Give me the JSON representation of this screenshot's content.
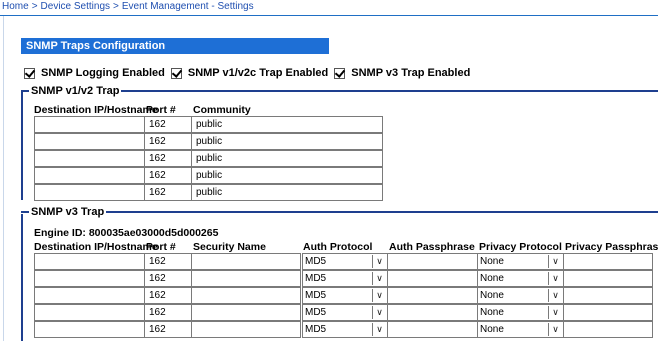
{
  "breadcrumb": {
    "home": "Home",
    "device_settings": "Device Settings",
    "current": "Event Management - Settings",
    "separator": ">"
  },
  "section_title": "SNMP Traps Configuration",
  "checkboxes": [
    {
      "label": "SNMP Logging Enabled",
      "checked": true
    },
    {
      "label": "SNMP v1/v2c Trap Enabled",
      "checked": true
    },
    {
      "label": "SNMP v3 Trap Enabled",
      "checked": true
    }
  ],
  "v1v2": {
    "legend": "SNMP v1/v2 Trap",
    "headers": {
      "destination": "Destination IP/Hostname",
      "port": "Port #",
      "community": "Community"
    },
    "rows": [
      {
        "destination": "",
        "port": "162",
        "community": "public"
      },
      {
        "destination": "",
        "port": "162",
        "community": "public"
      },
      {
        "destination": "",
        "port": "162",
        "community": "public"
      },
      {
        "destination": "",
        "port": "162",
        "community": "public"
      },
      {
        "destination": "",
        "port": "162",
        "community": "public"
      }
    ]
  },
  "v3": {
    "legend": "SNMP v3 Trap",
    "engine_id": "Engine ID: 800035ae03000d5d000265",
    "headers": {
      "destination": "Destination IP/Hostname",
      "port": "Port #",
      "security_name": "Security Name",
      "auth_protocol": "Auth Protocol",
      "auth_passphrase": "Auth Passphrase",
      "privacy_protocol": "Privacy Protocol",
      "privacy_passphrase": "Privacy Passphrase"
    },
    "rows": [
      {
        "destination": "",
        "port": "162",
        "security_name": "",
        "auth_protocol": "MD5",
        "auth_passphrase": "",
        "privacy_protocol": "None",
        "privacy_passphrase": ""
      },
      {
        "destination": "",
        "port": "162",
        "security_name": "",
        "auth_protocol": "MD5",
        "auth_passphrase": "",
        "privacy_protocol": "None",
        "privacy_passphrase": ""
      },
      {
        "destination": "",
        "port": "162",
        "security_name": "",
        "auth_protocol": "MD5",
        "auth_passphrase": "",
        "privacy_protocol": "None",
        "privacy_passphrase": ""
      },
      {
        "destination": "",
        "port": "162",
        "security_name": "",
        "auth_protocol": "MD5",
        "auth_passphrase": "",
        "privacy_protocol": "None",
        "privacy_passphrase": ""
      },
      {
        "destination": "",
        "port": "162",
        "security_name": "",
        "auth_protocol": "MD5",
        "auth_passphrase": "",
        "privacy_protocol": "None",
        "privacy_passphrase": ""
      }
    ]
  },
  "icons": {
    "dropdown": "chevron-down-icon",
    "checkbox": "checkmark-icon"
  },
  "colors": {
    "section_bar": "#1e6fd6",
    "link": "#1f4fb0",
    "fieldset_border": "#1e3f8f"
  }
}
